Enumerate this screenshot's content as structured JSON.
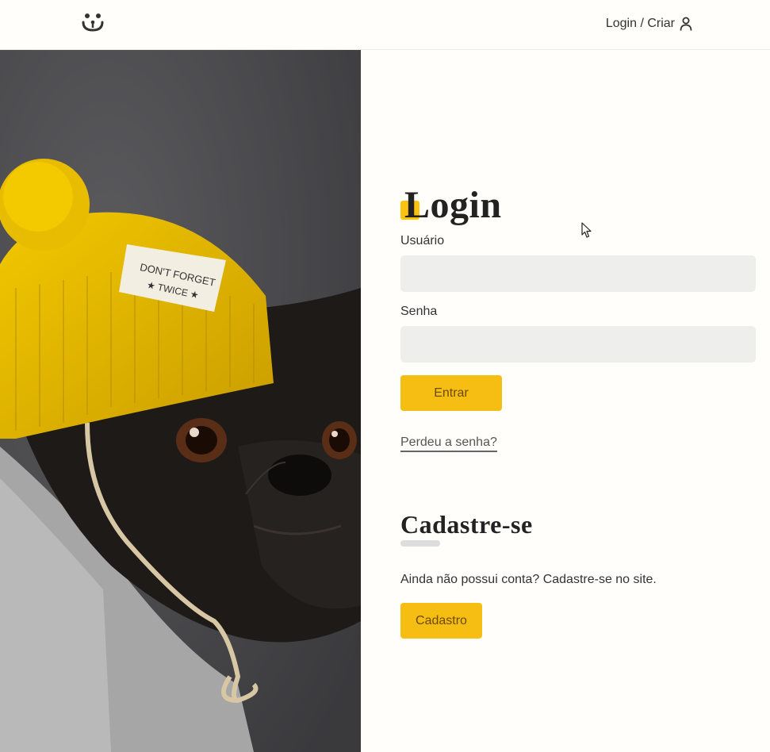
{
  "header": {
    "logo_icon": "dog-face-icon",
    "login_link": "Login / Criar",
    "user_icon": "user-icon"
  },
  "login": {
    "title": "Login",
    "username_label": "Usuário",
    "username_value": "",
    "password_label": "Senha",
    "password_value": "",
    "submit_label": "Entrar",
    "lost_password": "Perdeu a senha?"
  },
  "signup": {
    "title": "Cadastre-se",
    "text": "Ainda não possui conta? Cadastre-se no site.",
    "button_label": "Cadastro"
  },
  "colors": {
    "accent": "#fbc210",
    "button": "#f6bd12",
    "input_bg": "#eeeeec",
    "page_bg": "#fffefb"
  }
}
